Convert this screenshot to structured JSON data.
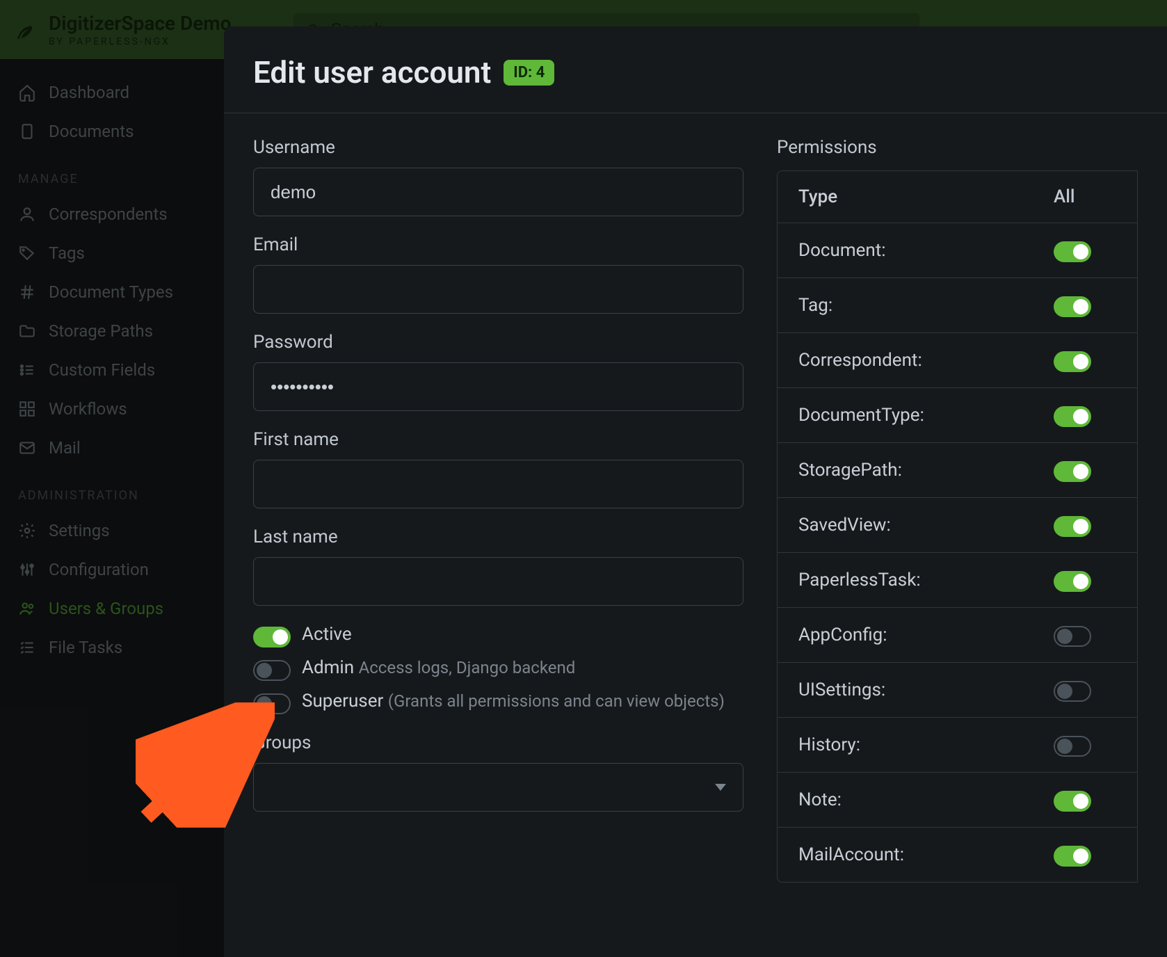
{
  "brand": {
    "title": "DigitizerSpace Demo",
    "subtitle": "BY PAPERLESS-NGX"
  },
  "search": {
    "placeholder": "Search"
  },
  "nav": {
    "top": [
      {
        "label": "Dashboard",
        "icon": "home"
      },
      {
        "label": "Documents",
        "icon": "file"
      }
    ],
    "manage_title": "MANAGE",
    "manage": [
      {
        "label": "Correspondents",
        "icon": "person"
      },
      {
        "label": "Tags",
        "icon": "tag"
      },
      {
        "label": "Document Types",
        "icon": "hash"
      },
      {
        "label": "Storage Paths",
        "icon": "folder"
      },
      {
        "label": "Custom Fields",
        "icon": "list"
      },
      {
        "label": "Workflows",
        "icon": "boxes"
      },
      {
        "label": "Mail",
        "icon": "mail"
      }
    ],
    "admin_title": "ADMINISTRATION",
    "admin": [
      {
        "label": "Settings",
        "icon": "gear"
      },
      {
        "label": "Configuration",
        "icon": "sliders"
      },
      {
        "label": "Users & Groups",
        "icon": "users",
        "active": true
      },
      {
        "label": "File Tasks",
        "icon": "checklist"
      }
    ]
  },
  "modal": {
    "title": "Edit user account",
    "id_label": "ID: 4",
    "fields": {
      "username_label": "Username",
      "username_value": "demo",
      "email_label": "Email",
      "email_value": "",
      "password_label": "Password",
      "password_value": "**********",
      "firstname_label": "First name",
      "firstname_value": "",
      "lastname_label": "Last name",
      "lastname_value": "",
      "groups_label": "Groups"
    },
    "toggles": {
      "active_label": "Active",
      "active_on": true,
      "admin_label": "Admin",
      "admin_hint": "Access logs, Django backend",
      "admin_on": false,
      "superuser_label": "Superuser",
      "superuser_hint": "(Grants all permissions and can view objects)",
      "superuser_on": false
    },
    "permissions": {
      "title": "Permissions",
      "header_type": "Type",
      "header_all": "All",
      "rows": [
        {
          "type": "Document:",
          "all": true
        },
        {
          "type": "Tag:",
          "all": true
        },
        {
          "type": "Correspondent:",
          "all": true
        },
        {
          "type": "DocumentType:",
          "all": true
        },
        {
          "type": "StoragePath:",
          "all": true
        },
        {
          "type": "SavedView:",
          "all": true
        },
        {
          "type": "PaperlessTask:",
          "all": true
        },
        {
          "type": "AppConfig:",
          "all": false
        },
        {
          "type": "UISettings:",
          "all": false
        },
        {
          "type": "History:",
          "all": false
        },
        {
          "type": "Note:",
          "all": true
        },
        {
          "type": "MailAccount:",
          "all": true
        }
      ]
    }
  }
}
